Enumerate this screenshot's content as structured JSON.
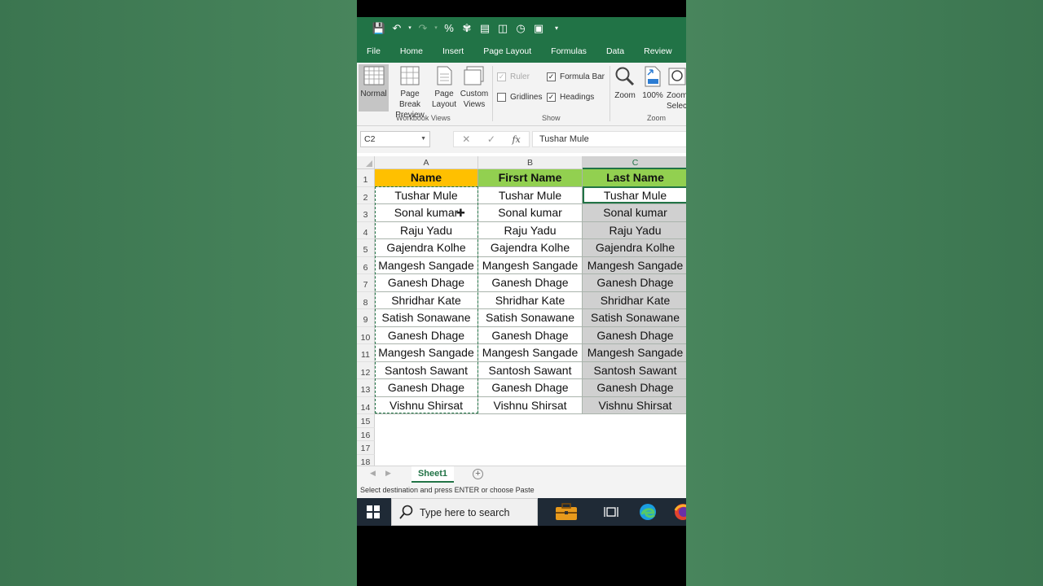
{
  "qat": {
    "icons": [
      "save-icon",
      "undo-icon",
      "redo-icon",
      "percent-icon",
      "brush-icon",
      "form-icon",
      "preview-icon",
      "send-icon",
      "camera-icon",
      "dropdown-icon"
    ],
    "percent_glyph": "%"
  },
  "tabs": [
    "File",
    "Home",
    "Insert",
    "Page Layout",
    "Formulas",
    "Data",
    "Review"
  ],
  "ribbon": {
    "workbook_views": {
      "label": "Workbook Views",
      "normal": "Normal",
      "page_break_1": "Page Break",
      "page_break_2": "Preview",
      "page_layout_1": "Page",
      "page_layout_2": "Layout",
      "custom_1": "Custom",
      "custom_2": "Views"
    },
    "show": {
      "label": "Show",
      "ruler": "Ruler",
      "formula_bar": "Formula Bar",
      "gridlines": "Gridlines",
      "headings": "Headings",
      "ruler_checked": true,
      "formula_bar_checked": true,
      "gridlines_checked": false,
      "headings_checked": true
    },
    "zoom": {
      "label": "Zoom",
      "zoom": "Zoom",
      "hundred": "100%",
      "zoom_sel_1": "Zoom",
      "zoom_sel_2": "Selec"
    }
  },
  "formula_bar": {
    "name_box": "C2",
    "cancel": "✕",
    "enter": "✓",
    "fx": "fx",
    "value": "Tushar Mule"
  },
  "grid": {
    "columns": [
      "A",
      "B",
      "C"
    ],
    "selected_column": "C",
    "rows_shown": [
      "1",
      "2",
      "3",
      "4",
      "5",
      "6",
      "7",
      "8",
      "9",
      "10",
      "11",
      "12",
      "13",
      "14",
      "15",
      "16",
      "17",
      "18"
    ],
    "headers": [
      "Name",
      "Firsrt Name",
      "Last Name"
    ],
    "data": [
      [
        "Tushar Mule",
        "Tushar Mule",
        "Tushar Mule"
      ],
      [
        "Sonal kumar",
        "Sonal kumar",
        "Sonal kumar"
      ],
      [
        "Raju Yadu",
        "Raju Yadu",
        "Raju Yadu"
      ],
      [
        "Gajendra Kolhe",
        "Gajendra Kolhe",
        "Gajendra Kolhe"
      ],
      [
        "Mangesh Sangade",
        "Mangesh Sangade",
        "Mangesh Sangade"
      ],
      [
        "Ganesh Dhage",
        "Ganesh Dhage",
        "Ganesh Dhage"
      ],
      [
        "Shridhar Kate",
        "Shridhar Kate",
        "Shridhar Kate"
      ],
      [
        "Satish Sonawane",
        "Satish Sonawane",
        "Satish Sonawane"
      ],
      [
        "Ganesh Dhage",
        "Ganesh Dhage",
        "Ganesh Dhage"
      ],
      [
        "Mangesh Sangade",
        "Mangesh Sangade",
        "Mangesh Sangade"
      ],
      [
        "Santosh Sawant",
        "Santosh Sawant",
        "Santosh Sawant"
      ],
      [
        "Ganesh Dhage",
        "Ganesh Dhage",
        "Ganesh Dhage"
      ],
      [
        "Vishnu Shirsat",
        "Vishnu Shirsat",
        "Vishnu Shirsat"
      ]
    ],
    "colors": {
      "header_a": "#ffc000",
      "header_bc": "#92d050",
      "selection": "#217346",
      "range_fill": "#d0d0d0"
    }
  },
  "sheets": {
    "active": "Sheet1"
  },
  "status": {
    "message": "Select destination and press ENTER or choose Paste"
  },
  "taskbar": {
    "search_placeholder": "Type here to search"
  },
  "colors": {
    "excel_green": "#217346"
  }
}
